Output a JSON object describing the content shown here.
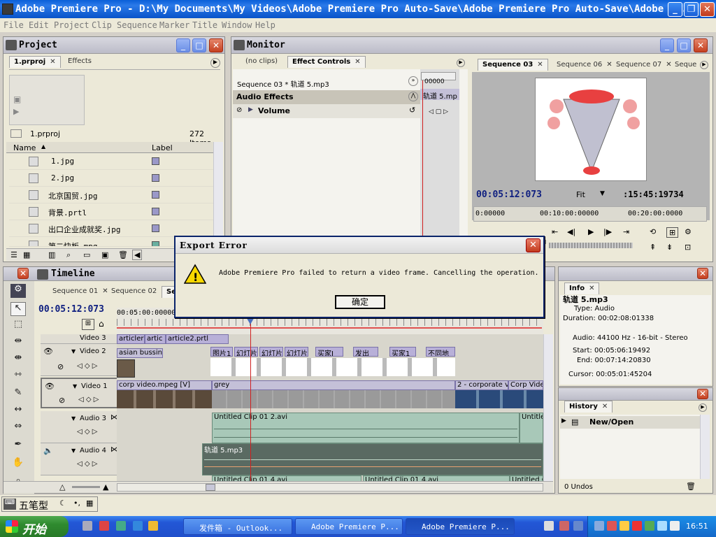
{
  "window": {
    "title": "Adobe Premiere Pro - D:\\My Documents\\My Videos\\Adobe Premiere Pro Auto-Save\\Adobe Premiere Pro Auto-Save\\Adobe Pr..."
  },
  "menu": [
    "File",
    "Edit",
    "Project",
    "Clip",
    "Sequence",
    "Marker",
    "Title",
    "Window",
    "Help"
  ],
  "project": {
    "title": "Project",
    "tabs": [
      "1.prproj",
      "Effects"
    ],
    "file": "1.prproj",
    "count": "272 Items",
    "col_name": "Name",
    "col_label": "Label",
    "items": [
      "1.jpg",
      "2.jpg",
      "北京国贸.jpg",
      "背景.prtl",
      "出口企业成就奖.jpg",
      "第二快板.mpg"
    ]
  },
  "monitor": {
    "title": "Monitor",
    "left_tabs": [
      "(no clips)",
      "Effect Controls"
    ],
    "seq_line": "Sequence 03 * 轨道 5.mp3",
    "timecode_small": "00000",
    "clip_small": "轨道 5.mp",
    "audio_effects": "Audio Effects",
    "volume": "Volume",
    "right_tabs": [
      "Sequence 03",
      "Sequence 06",
      "Sequence 07",
      "Seque"
    ],
    "timecode": "00:05:12:073",
    "fit": "Fit",
    "duration": ":15:45:19734",
    "ruler": [
      "0:00000",
      "00:10:00:00000",
      "00:20:00:0000"
    ]
  },
  "timeline": {
    "title": "Timeline",
    "tabs": [
      "Sequence 01",
      "Sequence 02",
      "Se"
    ],
    "timecode": "00:05:12:073",
    "ruler_tc": "00:05:00:00000",
    "tracks": [
      "Video 3",
      "Video 2",
      "Video 1",
      "Audio 3",
      "Audio 4"
    ],
    "video2_clips": [
      "asian bussiness",
      "图片1",
      "幻灯片",
      "幻灯片",
      "幻灯片",
      "买家J",
      "发出",
      "买家1",
      "不同地"
    ],
    "video3_clips": [
      "articler",
      "artic",
      "article2.prtl"
    ],
    "video1_clips": [
      "corp video.mpeg [V]",
      "grey",
      "2 - corporate vi",
      "Corp Vide"
    ],
    "audio3_clip": "Untitled Clip 01 2.avi",
    "audio3_clip2": "Untitle",
    "audio4_clip": "轨道 5.mp3",
    "audio5_clips": [
      "Untitled Clip 01 4.avi",
      "Untitled Clip 01 4.avi",
      "Untitled C"
    ]
  },
  "info": {
    "title": "Info",
    "name": "轨道 5.mp3",
    "type": "Type: Audio",
    "duration": "Duration: 00:02:08:01338",
    "audio": "Audio: 44100 Hz - 16-bit - Stereo",
    "start": "Start: 00:05:06:19492",
    "end": "End: 00:07:14:20830",
    "cursor": "Cursor: 00:05:01:45204"
  },
  "history": {
    "title": "History",
    "item": "New/Open",
    "undos": "0 Undos"
  },
  "dialog": {
    "title": "Export Error",
    "message": "Adobe Premiere Pro failed to return a video frame. Cancelling the operation.",
    "ok": "确定"
  },
  "ime": {
    "label": "五笔型"
  },
  "taskbar": {
    "start": "开始",
    "buttons": [
      "发件箱 - Outlook...",
      "Adobe Premiere P...",
      "Adobe Premiere P..."
    ],
    "clock": "16:51"
  },
  "colors": {
    "accent": "#2457c8",
    "dialog_border": "#0a246a",
    "playhead": "#d02020"
  }
}
